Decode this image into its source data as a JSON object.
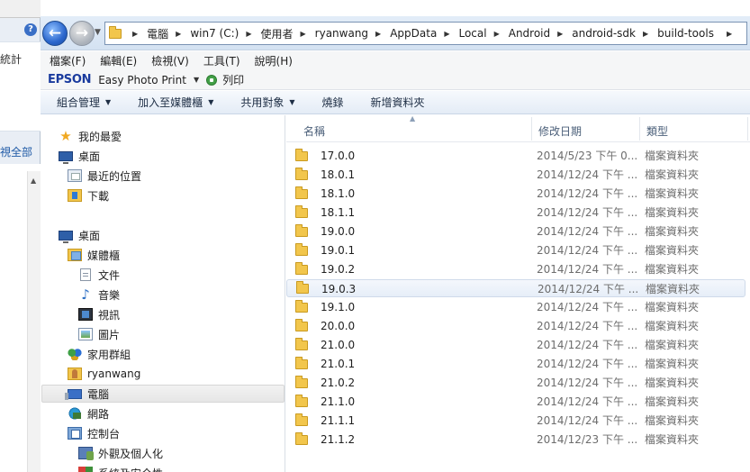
{
  "background_window": {
    "help_label": "?",
    "stat_label": "統計",
    "view_all_label": "視全部",
    "scroll_up": "▲"
  },
  "nav": {
    "back_arrow": "←",
    "forward_arrow": "→",
    "recent_arrow": "▼"
  },
  "address": {
    "crumbs": [
      "電腦",
      "win7 (C:)",
      "使用者",
      "ryanwang",
      "AppData",
      "Local",
      "Android",
      "android-sdk",
      "build-tools"
    ],
    "separator": "▶",
    "dropdown": "▶"
  },
  "menu": [
    "檔案(F)",
    "編輯(E)",
    "檢視(V)",
    "工具(T)",
    "說明(H)"
  ],
  "epson": {
    "logo": "EPSON",
    "app": "Easy Photo Print",
    "dropdown": "▼",
    "print_label": "列印"
  },
  "commands": [
    {
      "label": "組合管理",
      "dropdown": "▼"
    },
    {
      "label": "加入至媒體櫃",
      "dropdown": "▼"
    },
    {
      "label": "共用對象",
      "dropdown": "▼"
    },
    {
      "label": "燒錄",
      "dropdown": ""
    },
    {
      "label": "新增資料夾",
      "dropdown": ""
    }
  ],
  "sidebar": {
    "items": [
      {
        "label": "我的最愛",
        "icon": "star-icon"
      },
      {
        "label": "桌面",
        "icon": "desktop-icon"
      },
      {
        "label": "最近的位置",
        "icon": "recent-places-icon"
      },
      {
        "label": "下載",
        "icon": "downloads-icon"
      },
      {
        "label": "桌面",
        "icon": "desktop-icon"
      },
      {
        "label": "媒體櫃",
        "icon": "libraries-icon"
      },
      {
        "label": "文件",
        "icon": "documents-icon"
      },
      {
        "label": "音樂",
        "icon": "music-icon"
      },
      {
        "label": "視訊",
        "icon": "video-icon"
      },
      {
        "label": "圖片",
        "icon": "pictures-icon"
      },
      {
        "label": "家用群組",
        "icon": "homegroup-icon"
      },
      {
        "label": "ryanwang",
        "icon": "user-folder-icon"
      },
      {
        "label": "電腦",
        "icon": "computer-icon",
        "selected": true
      },
      {
        "label": "網路",
        "icon": "network-icon"
      },
      {
        "label": "控制台",
        "icon": "control-panel-icon"
      },
      {
        "label": "外觀及個人化",
        "icon": "personalization-icon"
      },
      {
        "label": "系統及安全性",
        "icon": "system-security-icon"
      }
    ]
  },
  "columns": {
    "name": "名稱",
    "date": "修改日期",
    "type": "類型",
    "sort_indicator": "▲"
  },
  "files": [
    {
      "name": "17.0.0",
      "date": "2014/5/23 下午 0...",
      "type": "檔案資料夾"
    },
    {
      "name": "18.0.1",
      "date": "2014/12/24 下午 ...",
      "type": "檔案資料夾"
    },
    {
      "name": "18.1.0",
      "date": "2014/12/24 下午 ...",
      "type": "檔案資料夾"
    },
    {
      "name": "18.1.1",
      "date": "2014/12/24 下午 ...",
      "type": "檔案資料夾"
    },
    {
      "name": "19.0.0",
      "date": "2014/12/24 下午 ...",
      "type": "檔案資料夾"
    },
    {
      "name": "19.0.1",
      "date": "2014/12/24 下午 ...",
      "type": "檔案資料夾"
    },
    {
      "name": "19.0.2",
      "date": "2014/12/24 下午 ...",
      "type": "檔案資料夾"
    },
    {
      "name": "19.0.3",
      "date": "2014/12/24 下午 ...",
      "type": "檔案資料夾",
      "selected": true
    },
    {
      "name": "19.1.0",
      "date": "2014/12/24 下午 ...",
      "type": "檔案資料夾"
    },
    {
      "name": "20.0.0",
      "date": "2014/12/24 下午 ...",
      "type": "檔案資料夾"
    },
    {
      "name": "21.0.0",
      "date": "2014/12/24 下午 ...",
      "type": "檔案資料夾"
    },
    {
      "name": "21.0.1",
      "date": "2014/12/24 下午 ...",
      "type": "檔案資料夾"
    },
    {
      "name": "21.0.2",
      "date": "2014/12/24 下午 ...",
      "type": "檔案資料夾"
    },
    {
      "name": "21.1.0",
      "date": "2014/12/24 下午 ...",
      "type": "檔案資料夾"
    },
    {
      "name": "21.1.1",
      "date": "2014/12/24 下午 ...",
      "type": "檔案資料夾"
    },
    {
      "name": "21.1.2",
      "date": "2014/12/23 下午 ...",
      "type": "檔案資料夾"
    }
  ]
}
